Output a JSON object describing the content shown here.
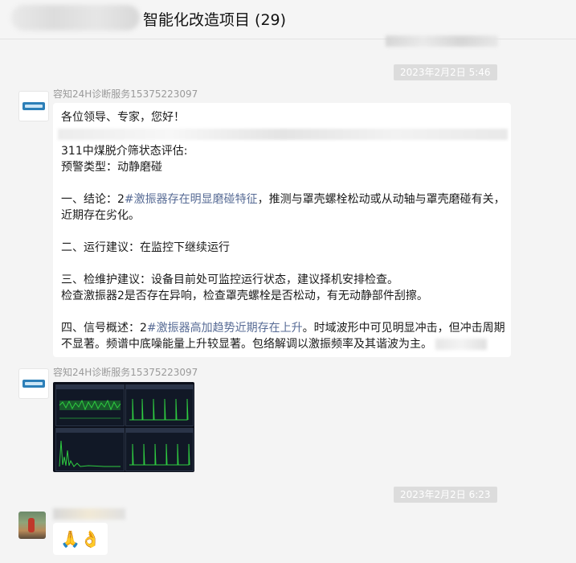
{
  "header": {
    "title": "智能化改造项目 (29)"
  },
  "timestamps": {
    "first": "2023年2月2日 5:46",
    "second": "2023年2月2日 6:23"
  },
  "messages": [
    {
      "sender": "容知24H诊断服务15375223097",
      "greeting": "各位领导、专家，您好！",
      "line1": "311中煤脱介筛状态评估:",
      "line2": "预警类型：动静磨碰",
      "c1_prefix": "一、结论：2",
      "c1_accent": "#激振器存在明显磨碰特征",
      "c1_suffix": "，推测与罩壳螺栓松动或从动轴与罩壳磨碰有关，",
      "c1_line2": "近期存在劣化。",
      "c2": "二、运行建议：在监控下继续运行",
      "c3_line1": "三、检维护建议：设备目前处可监控运行状态，建议择机安排检查。",
      "c3_line2": "检查激振器2是否存在异响，检查罩壳螺栓是否松动，有无动静部件刮擦。",
      "c4_prefix": "四、信号概述：2",
      "c4_accent": "#激振器高加趋势近期存在上升",
      "c4_suffix": "。时域波形中可见明显冲击，但冲击周期",
      "c4_line2": "不显著。频谱中底噪能量上升较显著。包络解调以激振频率及其谐波为主。"
    },
    {
      "sender": "容知24H诊断服务15375223097"
    }
  ],
  "reaction": {
    "emojis": "🙏👌"
  },
  "colors": {
    "accent": "#576b95",
    "chart_green": "#2ecc40",
    "bubble": "#ffffff",
    "background": "#f4f4f4"
  }
}
